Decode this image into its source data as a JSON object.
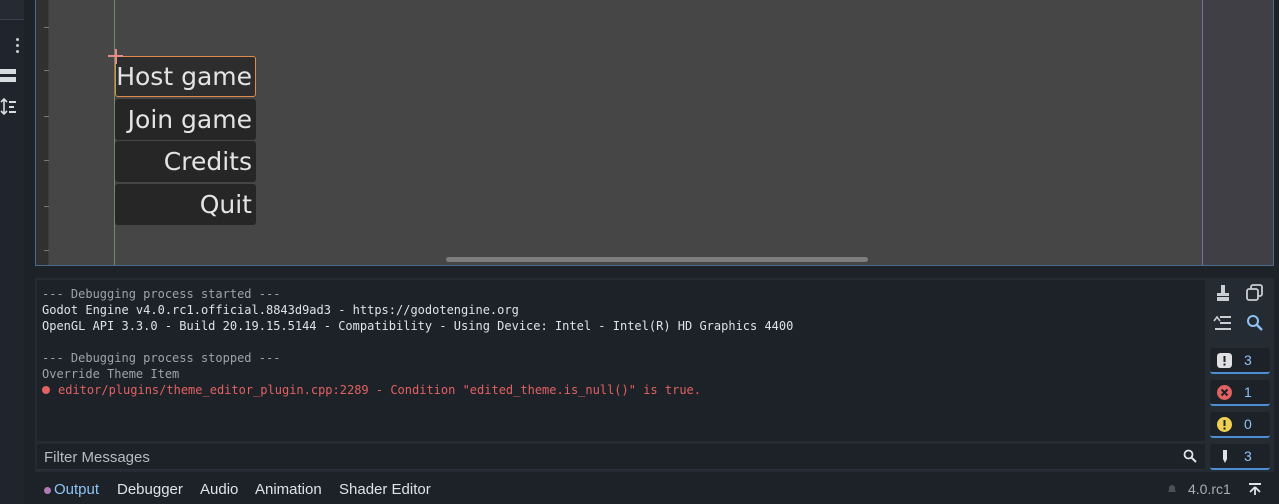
{
  "viewport": {
    "buttons": [
      "Host game",
      "Join game",
      "Credits",
      "Quit"
    ],
    "selected_button": "Host game"
  },
  "output": {
    "lines": [
      {
        "text": "--- Debugging process started ---",
        "kind": "dim"
      },
      {
        "text": "Godot Engine v4.0.rc1.official.8843d9ad3 - https://godotengine.org",
        "kind": "norm"
      },
      {
        "text": "OpenGL API 3.3.0 - Build 20.19.15.5144 - Compatibility - Using Device: Intel - Intel(R) HD Graphics 4400",
        "kind": "norm"
      },
      {
        "text": "",
        "kind": "norm"
      },
      {
        "text": "--- Debugging process stopped ---",
        "kind": "dim"
      },
      {
        "text": "Override Theme Item",
        "kind": "dim"
      },
      {
        "text": "editor/plugins/theme_editor_plugin.cpp:2289 - Condition \"edited_theme.is_null()\" is true.",
        "kind": "err"
      }
    ],
    "filter_placeholder": "Filter Messages",
    "counters": {
      "messages": "3",
      "errors": "1",
      "warnings": "0",
      "editor": "3"
    },
    "colors": {
      "error": "#e26161",
      "warning": "#f0d050",
      "accent": "#8fc2f5"
    }
  },
  "tabs": {
    "output": "Output",
    "debugger": "Debugger",
    "audio": "Audio",
    "animation": "Animation",
    "shader_editor": "Shader Editor",
    "active": "Output"
  },
  "status": {
    "version": "4.0.rc1"
  }
}
